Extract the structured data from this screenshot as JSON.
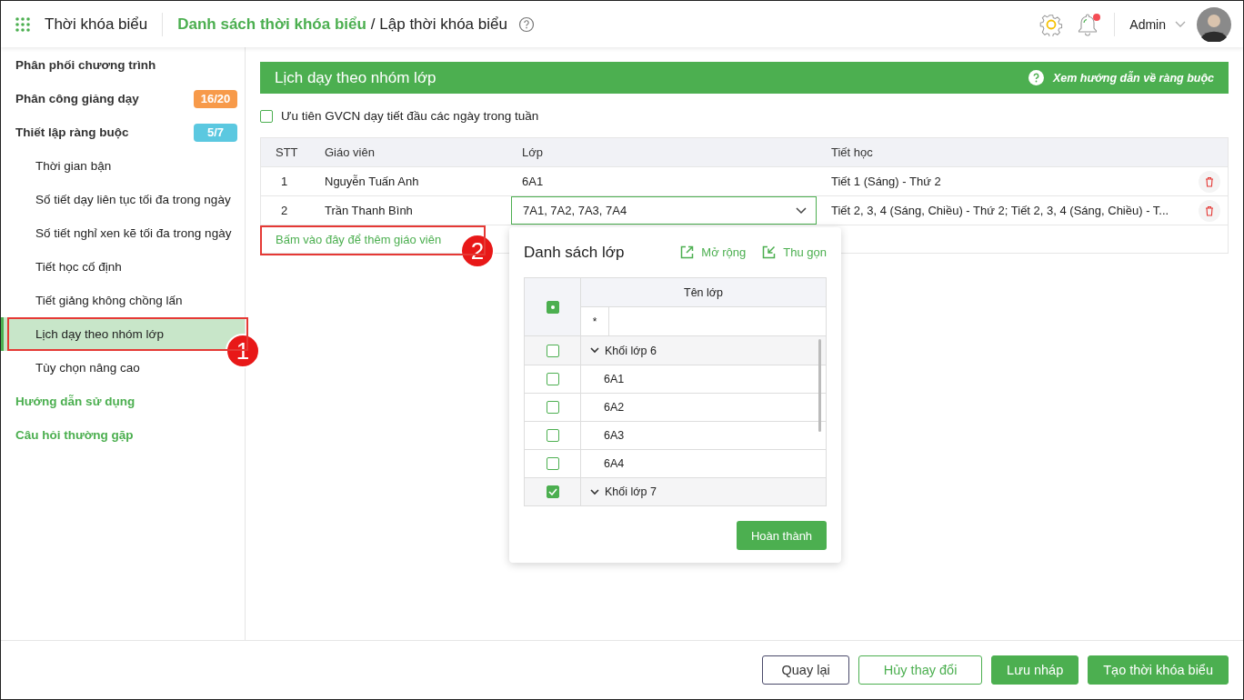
{
  "header": {
    "app_title": "Thời khóa biểu",
    "breadcrumb_link": "Danh sách thời khóa biểu",
    "breadcrumb_current": "/ Lập thời khóa biểu",
    "user": "Admin",
    "notification_unread": true
  },
  "sidebar": {
    "items": [
      {
        "label": "Phân phối chương trình",
        "kind": "section"
      },
      {
        "label": "Phân công giảng dạy",
        "kind": "section",
        "badge": "16/20",
        "color": "#f79a4a"
      },
      {
        "label": "Thiết lập ràng buộc",
        "kind": "section",
        "badge": "5/7",
        "color": "#5bc8e0",
        "children": [
          {
            "label": "Thời gian bận",
            "selected": false
          },
          {
            "label": "Số tiết dạy liên tục tối đa trong ngày",
            "selected": false
          },
          {
            "label": "Số tiết nghỉ xen kẽ tối đa trong ngày",
            "selected": false
          },
          {
            "label": "Tiết học cố định",
            "selected": false
          },
          {
            "label": "Tiết giảng không chồng lấn",
            "selected": false
          },
          {
            "label": "Lịch dạy theo nhóm lớp",
            "selected": true
          },
          {
            "label": "Tùy chọn nâng cao",
            "selected": false
          }
        ]
      },
      {
        "label": "Hướng dẫn sử dụng",
        "kind": "link"
      },
      {
        "label": "Câu hỏi thường gặp",
        "kind": "link"
      }
    ]
  },
  "panel": {
    "title": "Lịch dạy theo nhóm lớp",
    "help_link": "Xem hướng dẫn về ràng buộc",
    "option": {
      "label": "Ưu tiên GVCN dạy tiết đầu các ngày trong tuần",
      "checked": false
    },
    "table": {
      "columns": [
        "STT",
        "Giáo viên",
        "Lớp",
        "Tiết học"
      ],
      "rows": [
        {
          "stt": "1",
          "teacher": "Nguyễn Tuấn Anh",
          "class": "6A1",
          "periods": "Tiết 1 (Sáng) - Thứ 2",
          "editing": false
        },
        {
          "stt": "2",
          "teacher": "Trần Thanh Bình",
          "class": "7A1, 7A2, 7A3, 7A4",
          "periods": "Tiết 2, 3, 4 (Sáng, Chiều) - Thứ 2; Tiết 2, 3, 4 (Sáng, Chiều) - T...",
          "editing": true
        }
      ]
    },
    "add_link": "Bấm vào đây để thêm giáo viên"
  },
  "class_popup": {
    "title": "Danh sách lớp",
    "actions": [
      "Mở rộng",
      "Thu gọn"
    ],
    "column": "Tên lớp",
    "filter": "*",
    "select_all_partial": true,
    "rows": [
      {
        "label": "Khối lớp 6",
        "kind": "group",
        "checked": false
      },
      {
        "label": "6A1",
        "kind": "item",
        "checked": false
      },
      {
        "label": "6A2",
        "kind": "item",
        "checked": false
      },
      {
        "label": "6A3",
        "kind": "item",
        "checked": false
      },
      {
        "label": "6A4",
        "kind": "item",
        "checked": false
      },
      {
        "label": "Khối lớp 7",
        "kind": "group",
        "checked": true
      }
    ],
    "done_button": "Hoàn thành"
  },
  "callouts": [
    "1",
    "2"
  ],
  "footer": {
    "buttons": [
      {
        "label": "Quay lại",
        "kind": "outline"
      },
      {
        "label": "Hủy thay đổi",
        "kind": "outline-green"
      },
      {
        "label": "Lưu nháp",
        "kind": "primary"
      },
      {
        "label": "Tạo thời khóa biểu",
        "kind": "primary"
      }
    ]
  }
}
